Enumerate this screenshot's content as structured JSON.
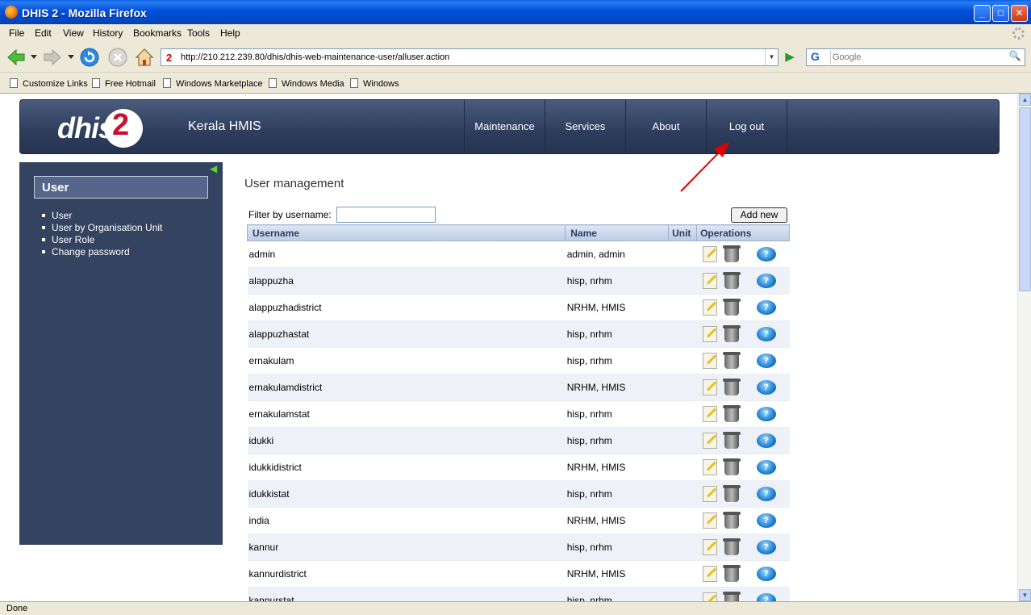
{
  "window": {
    "title": "DHIS 2 - Mozilla Firefox"
  },
  "menu": [
    "File",
    "Edit",
    "View",
    "History",
    "Bookmarks",
    "Tools",
    "Help"
  ],
  "address": {
    "site_icon": "2",
    "url": "http://210.212.239.80/dhis/dhis-web-maintenance-user/alluser.action"
  },
  "search": {
    "placeholder": "Google",
    "engine_icon": "G"
  },
  "bookmarks": [
    "Customize Links",
    "Free Hotmail",
    "Windows Marketplace",
    "Windows Media",
    "Windows"
  ],
  "header": {
    "logo_text": "dhis",
    "logo_number": "2",
    "org_name": "Kerala HMIS",
    "nav": [
      "Maintenance",
      "Services",
      "About",
      "Log out"
    ]
  },
  "sidebar": {
    "title": "User",
    "items": [
      "User",
      "User by Organisation Unit",
      "User Role",
      "Change password"
    ]
  },
  "main": {
    "title": "User management",
    "filter_label": "Filter by username:",
    "add_new": "Add new",
    "columns": [
      "Username",
      "Name",
      "Unit",
      "Operations"
    ],
    "rows": [
      {
        "username": "admin",
        "name": "admin, admin"
      },
      {
        "username": "alappuzha",
        "name": "hisp, nrhm"
      },
      {
        "username": "alappuzhadistrict",
        "name": "NRHM, HMIS"
      },
      {
        "username": "alappuzhastat",
        "name": "hisp, nrhm"
      },
      {
        "username": "ernakulam",
        "name": "hisp, nrhm"
      },
      {
        "username": "ernakulamdistrict",
        "name": "NRHM, HMIS"
      },
      {
        "username": "ernakulamstat",
        "name": "hisp, nrhm"
      },
      {
        "username": "idukki",
        "name": "hisp, nrhm"
      },
      {
        "username": "idukkidistrict",
        "name": "NRHM, HMIS"
      },
      {
        "username": "idukkistat",
        "name": "hisp, nrhm"
      },
      {
        "username": "india",
        "name": "NRHM, HMIS"
      },
      {
        "username": "kannur",
        "name": "hisp, nrhm"
      },
      {
        "username": "kannurdistrict",
        "name": "NRHM, HMIS"
      },
      {
        "username": "kannurstat",
        "name": "hisp, nrhm"
      }
    ]
  },
  "status": {
    "text": "Done"
  },
  "colors": {
    "header_bg": "#34435f",
    "annotation_arrow": "#e00000",
    "title_bar": "#0050d8"
  }
}
